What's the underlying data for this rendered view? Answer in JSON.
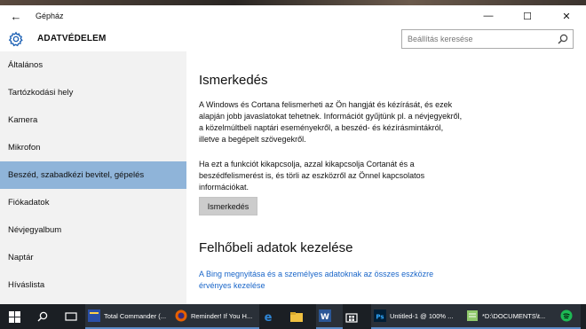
{
  "window": {
    "title": "Gépház",
    "back_glyph": "←",
    "minimize_glyph": "—",
    "maximize_glyph": "☐",
    "close_glyph": "✕"
  },
  "header": {
    "title": "ADATVÉDELEM",
    "search_placeholder": "Beállítás keresése"
  },
  "sidebar": {
    "items": [
      {
        "label": "Általános",
        "active": false
      },
      {
        "label": "Tartózkodási hely",
        "active": false
      },
      {
        "label": "Kamera",
        "active": false
      },
      {
        "label": "Mikrofon",
        "active": false
      },
      {
        "label": "Beszéd, szabadkézi bevitel, gépelés",
        "active": true
      },
      {
        "label": "Fiókadatok",
        "active": false
      },
      {
        "label": "Névjegyalbum",
        "active": false
      },
      {
        "label": "Naptár",
        "active": false
      },
      {
        "label": "Híváslista",
        "active": false
      }
    ]
  },
  "content": {
    "section1_title": "Ismerkedés",
    "section1_text": "A Windows és Cortana felismerheti az Ön hangját és kézírását, és ezek alapján jobb javaslatokat tehetnek. Információt gyűjtünk pl. a névjegyekről, a közelmúltbeli naptári eseményekről, a beszéd- és kézírásmintákról, illetve a begépelt szövegekről.",
    "section1_text2": "Ha ezt a funkciót kikapcsolja, azzal kikapcsolja Cortanát és a beszédfelismerést is, és törli az eszközről az Önnel kapcsolatos információkat.",
    "button_label": "Ismerkedés",
    "section2_title": "Felhőbeli adatok kezelése",
    "link_text": "A Bing megnyitása és a személyes adatoknak az összes eszközre érvényes kezelése"
  },
  "taskbar": {
    "apps": [
      {
        "label": "Total Commander (...",
        "icon": "total-commander-icon",
        "color": "#2a4fa8"
      },
      {
        "label": "Reminder! If You H...",
        "icon": "firefox-icon",
        "color": "#e66000"
      },
      {
        "label": "",
        "icon": "edge-icon",
        "color": "#2f86d6"
      },
      {
        "label": "",
        "icon": "file-explorer-icon",
        "color": "#f0c040"
      },
      {
        "label": "",
        "icon": "word-icon",
        "color": "#2b5797"
      },
      {
        "label": "",
        "icon": "store-icon",
        "color": "#ffffff"
      },
      {
        "label": "Untitled-1 @ 100% ...",
        "icon": "photoshop-icon",
        "color": "#31a8ff"
      },
      {
        "label": "*D:\\DOCUMENTS\\t...",
        "icon": "notepad-icon",
        "color": "#8fc96b"
      },
      {
        "label": "",
        "icon": "spotify-icon",
        "color": "#1db954"
      }
    ]
  },
  "colors": {
    "accent_active": "#8fb4d9",
    "link": "#1a66c9",
    "sidebar_bg": "#f2f2f2",
    "taskbar_bg": "#1b1f24"
  }
}
